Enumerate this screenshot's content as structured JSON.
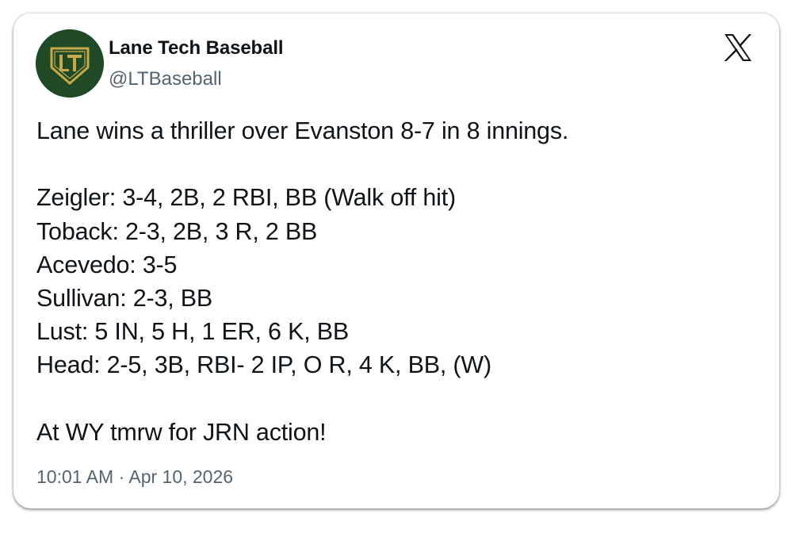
{
  "tweet": {
    "author": {
      "display_name": "Lane Tech Baseball",
      "handle": "@LTBaseball",
      "avatar_icon": "lt-logo-icon",
      "avatar_colors": {
        "background": "#1f4a25",
        "plate": "#c8a94a"
      }
    },
    "platform_icon": "x-logo-icon",
    "paragraphs": [
      {
        "lines": [
          "Lane wins a thriller over Evanston 8-7 in 8 innings."
        ]
      },
      {
        "lines": [
          "Zeigler: 3-4, 2B, 2 RBI, BB (Walk off hit)",
          "Toback: 2-3, 2B, 3 R, 2 BB",
          "Acevedo: 3-5",
          "Sullivan: 2-3, BB",
          "Lust: 5 IN, 5 H, 1 ER, 6 K, BB",
          "Head: 2-5, 3B, RBI- 2 IP, O R, 4 K, BB, (W)"
        ]
      },
      {
        "lines": [
          "At WY tmrw for JRN action!"
        ]
      }
    ],
    "timestamp": "10:01 AM · Apr 10, 2026"
  }
}
